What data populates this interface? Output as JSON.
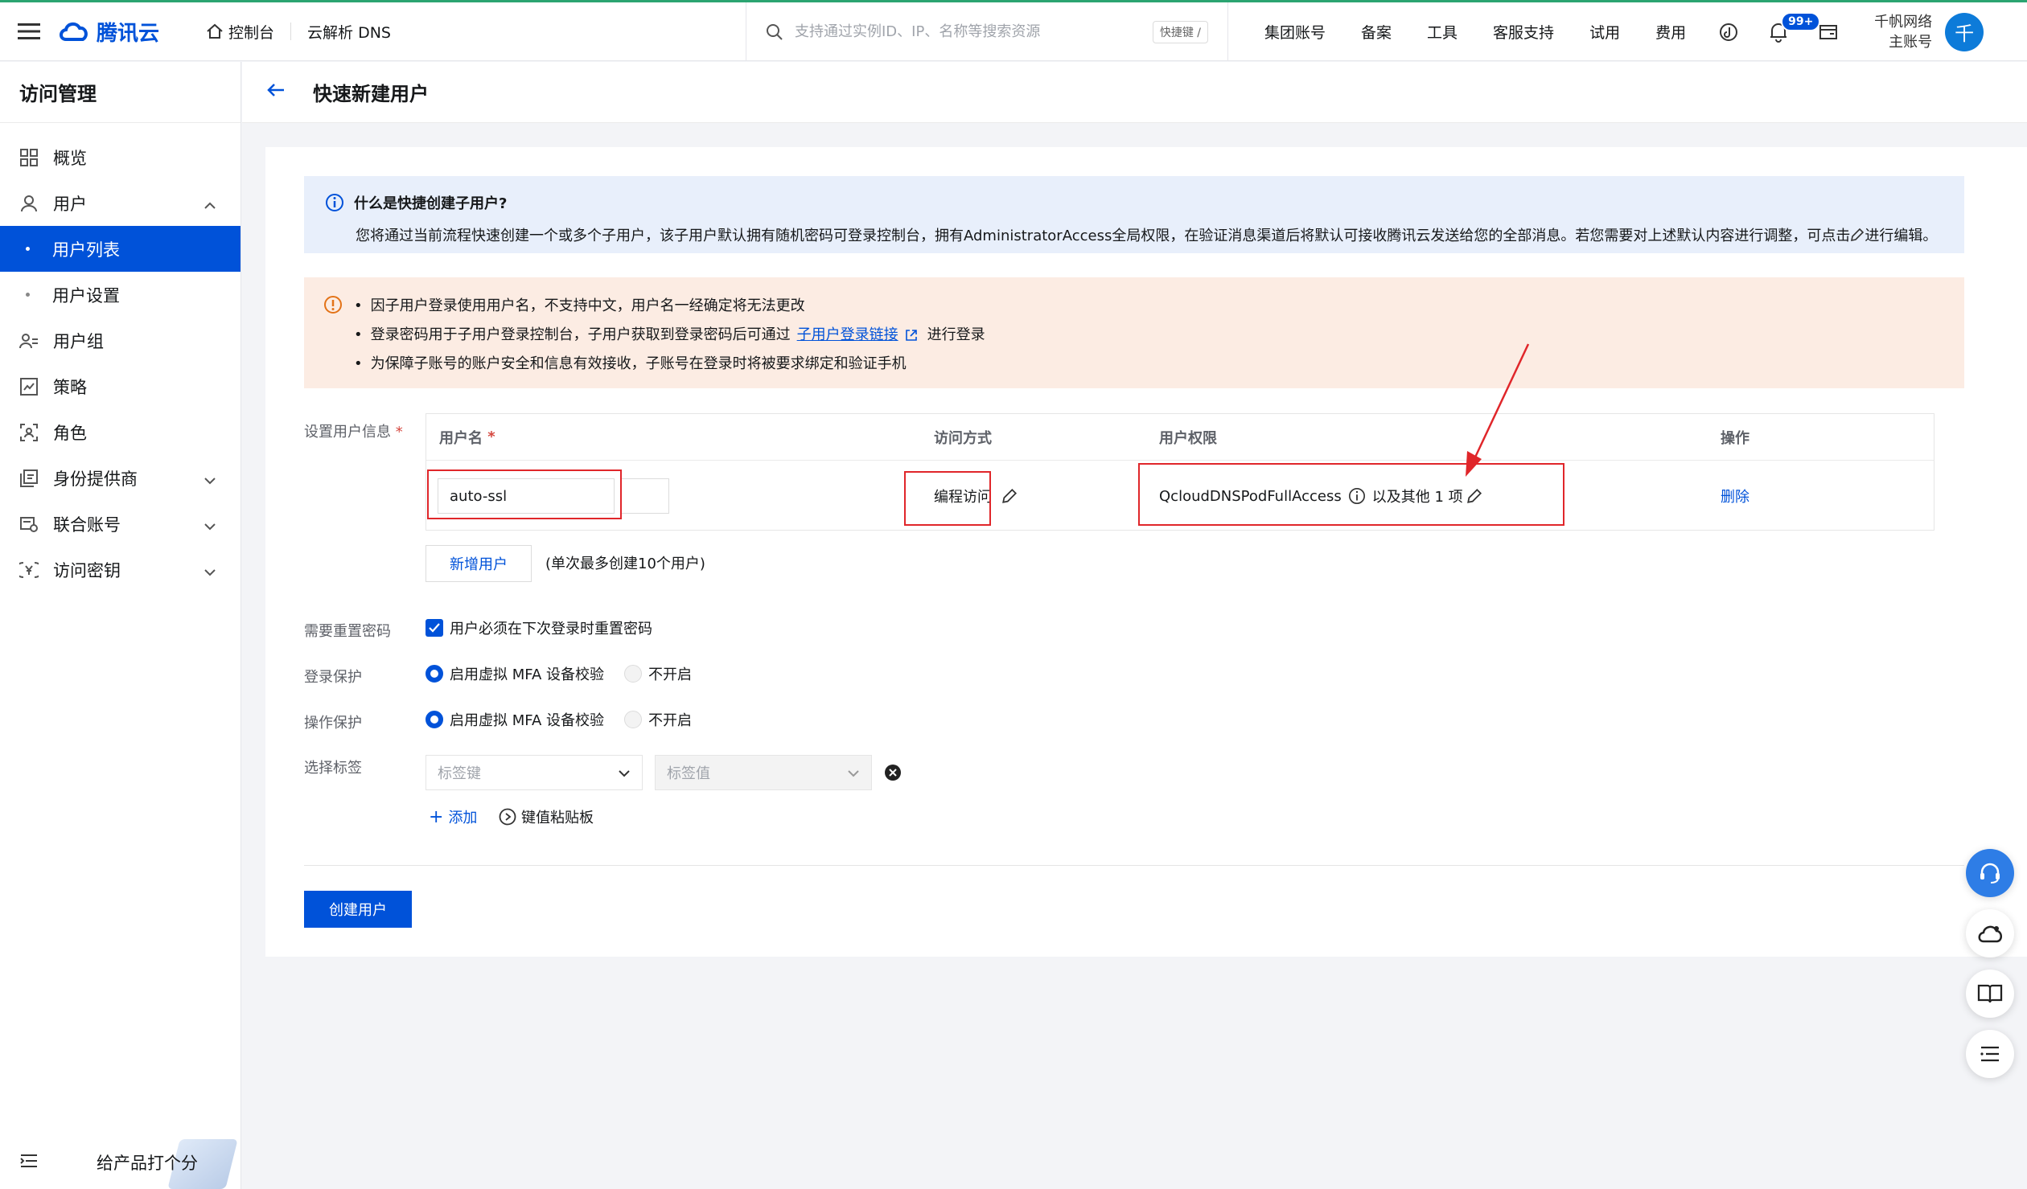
{
  "topbar": {
    "brand": "腾讯云",
    "console": "控制台",
    "product": "云解析 DNS",
    "search_placeholder": "支持通过实例ID、IP、名称等搜索资源",
    "shortcut": "快捷键 /",
    "nav": [
      "集团账号",
      "备案",
      "工具",
      "客服支持",
      "试用",
      "费用"
    ],
    "notification_badge": "99+",
    "org_name": "千帆网络",
    "account_type": "主账号",
    "avatar_letter": "千"
  },
  "sidebar": {
    "title": "访问管理",
    "items": [
      {
        "label": "概览"
      },
      {
        "label": "用户"
      },
      {
        "label": "用户列表"
      },
      {
        "label": "用户设置"
      },
      {
        "label": "用户组"
      },
      {
        "label": "策略"
      },
      {
        "label": "角色"
      },
      {
        "label": "身份提供商"
      },
      {
        "label": "联合账号"
      },
      {
        "label": "访问密钥"
      }
    ],
    "rate_text": "给产品打个分"
  },
  "page": {
    "title": "快速新建用户"
  },
  "info": {
    "title": "什么是快捷创建子用户?",
    "text": "您将通过当前流程快速创建一个或多个子用户，该子用户默认拥有随机密码可登录控制台，拥有AdministratorAccess全局权限，在验证消息渠道后将默认可接收腾讯云发送给您的全部消息。若您需要对上述默认内容进行调整，可点击",
    "text_tail": "进行编辑。"
  },
  "warning": {
    "line1": "因子用户登录使用用户名，不支持中文，用户名一经确定将无法更改",
    "line2_pre": "登录密码用于子用户登录控制台，子用户获取到登录密码后可通过",
    "line2_link": "子用户登录链接",
    "line2_post": "进行登录",
    "line3": "为保障子账号的账户安全和信息有效接收，子账号在登录时将被要求绑定和验证手机"
  },
  "form": {
    "user_info_label": "设置用户信息",
    "columns": {
      "username": "用户名",
      "access": "访问方式",
      "permission": "用户权限",
      "operation": "操作"
    },
    "row": {
      "username": "auto-ssl",
      "access": "编程访问",
      "permission": "QcloudDNSPodFullAccess",
      "permission_more": "以及其他 1 项",
      "delete": "删除"
    },
    "add_user": "新增用户",
    "add_hint": "(单次最多创建10个用户)",
    "reset_pwd_label": "需要重置密码",
    "reset_pwd_option": "用户必须在下次登录时重置密码",
    "login_protect_label": "登录保护",
    "op_protect_label": "操作保护",
    "mfa_on": "启用虚拟 MFA 设备校验",
    "mfa_off": "不开启",
    "tag_label": "选择标签",
    "tag_key_placeholder": "标签键",
    "tag_value_placeholder": "标签值",
    "add_tag": "添加",
    "paste_tag": "键值粘贴板",
    "submit": "创建用户"
  }
}
